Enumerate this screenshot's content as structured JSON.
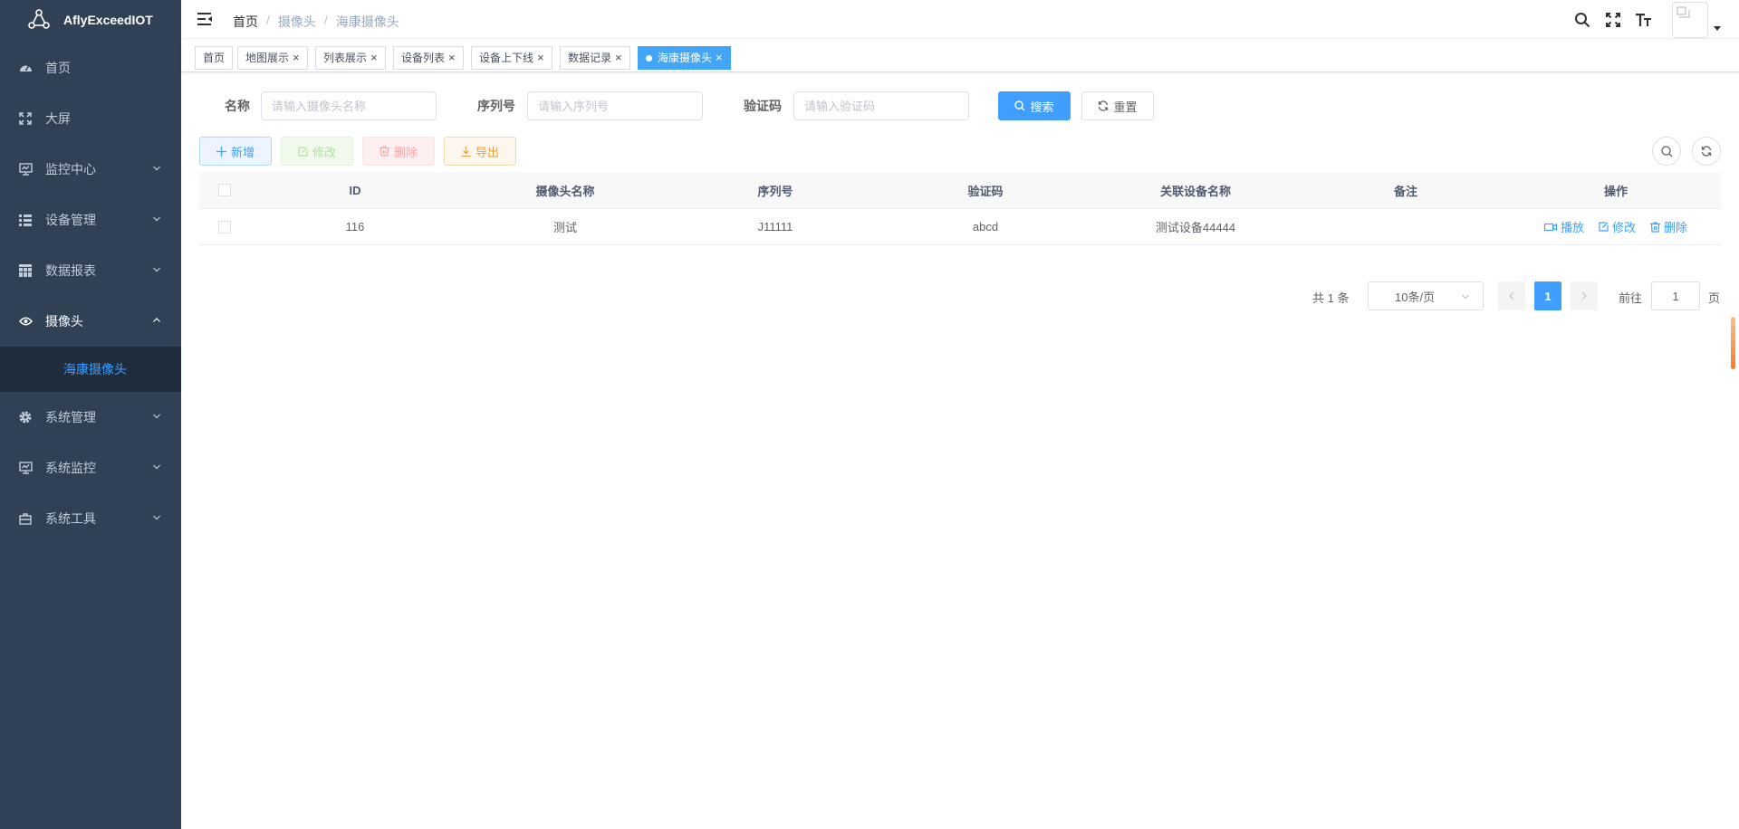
{
  "app": {
    "title": "AflyExceedIOT"
  },
  "sidebar": {
    "items": [
      {
        "label": "首页",
        "icon": "dashboard-icon"
      },
      {
        "label": "大屏",
        "icon": "fullscreen-icon"
      },
      {
        "label": "监控中心",
        "icon": "monitor-icon"
      },
      {
        "label": "设备管理",
        "icon": "list-icon"
      },
      {
        "label": "数据报表",
        "icon": "table-icon"
      },
      {
        "label": "摄像头",
        "icon": "eye-icon"
      },
      {
        "label": "系统管理",
        "icon": "gear-icon"
      },
      {
        "label": "系统监控",
        "icon": "monitor-icon"
      },
      {
        "label": "系统工具",
        "icon": "toolbox-icon"
      }
    ],
    "submenu": {
      "label": "海康摄像头"
    }
  },
  "breadcrumb": [
    "首页",
    "摄像头",
    "海康摄像头"
  ],
  "tags": [
    {
      "label": "首页"
    },
    {
      "label": "地图展示"
    },
    {
      "label": "列表展示"
    },
    {
      "label": "设备列表"
    },
    {
      "label": "设备上下线"
    },
    {
      "label": "数据记录"
    },
    {
      "label": "海康摄像头"
    }
  ],
  "search": {
    "name_label": "名称",
    "name_placeholder": "请输入摄像头名称",
    "serial_label": "序列号",
    "serial_placeholder": "请输入序列号",
    "code_label": "验证码",
    "code_placeholder": "请输入验证码",
    "search_button": "搜索",
    "reset_button": "重置"
  },
  "toolbar": {
    "add": "新增",
    "edit": "修改",
    "delete": "删除",
    "export": "导出"
  },
  "table": {
    "columns": [
      "ID",
      "摄像头名称",
      "序列号",
      "验证码",
      "关联设备名称",
      "备注",
      "操作"
    ],
    "rows": [
      {
        "id": "116",
        "name": "测试",
        "serial": "J11111",
        "code": "abcd",
        "device": "测试设备44444",
        "remark": ""
      }
    ],
    "actions": {
      "play": "播放",
      "edit": "修改",
      "delete": "删除"
    }
  },
  "pagination": {
    "total": "共 1 条",
    "page_size": "10条/页",
    "current": "1",
    "goto_label": "前往",
    "goto_value": "1",
    "page_suffix": "页"
  },
  "colors": {
    "sidebar_bg": "#304156",
    "primary": "#409eff",
    "submenu_bg": "#1f2d3d"
  }
}
